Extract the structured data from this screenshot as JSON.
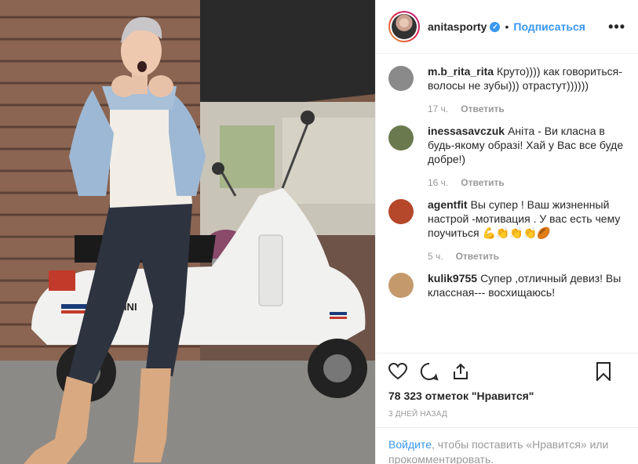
{
  "post": {
    "username": "anitasporty",
    "verified_mark": "✓",
    "separator": "•",
    "follow_label": "Подписаться",
    "more_label": "•••"
  },
  "comments": [
    {
      "user": "m.b_rita_rita",
      "text": "Круто)))) как говориться- волосы не зубы))) отрастут))))))",
      "time": "17 ч.",
      "reply": "Ответить",
      "avatar_color": "#8a8a8a"
    },
    {
      "user": "inessasavczuk",
      "text": "Аніта - Ви класна в будь-якому образі! Хай у Вас все буде добре!)",
      "time": "16 ч.",
      "reply": "Ответить",
      "avatar_color": "#6b7a4e"
    },
    {
      "user": "agentfit",
      "text": "Вы супер ! Ваш жизненный настрой -мотивация . У вас есть чему поучиться 💪👏👏👏🏉",
      "time": "5 ч.",
      "reply": "Ответить",
      "avatar_color": "#b5482a"
    },
    {
      "user": "kulik9755",
      "text": "Супер ,отличный девиз! Вы классная--- восхищаюсь!",
      "time": "",
      "reply": "",
      "avatar_color": "#c49a6c"
    }
  ],
  "actions": {
    "like_icon": "heart-icon",
    "comment_icon": "comment-icon",
    "share_icon": "share-icon",
    "save_icon": "bookmark-icon"
  },
  "likes_text": "78 323 отметок \"Нравится\"",
  "date_text": "3 дней назад",
  "login": {
    "link": "Войдите",
    "rest": ", чтобы поставить «Нравится» или прокомментировать."
  },
  "photo_text": {
    "scooter_badge": "TINI"
  },
  "colors": {
    "accent": "#3897f0",
    "text": "#262626",
    "muted": "#999999",
    "border": "#efefef"
  }
}
